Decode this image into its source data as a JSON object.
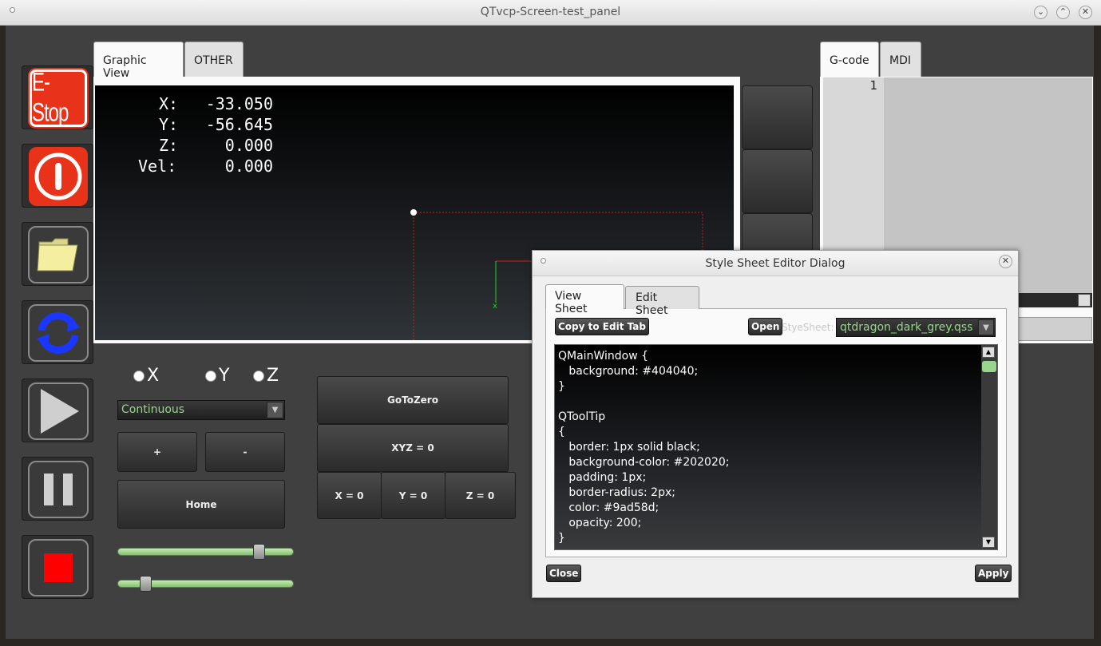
{
  "window": {
    "title": "QTvcp-Screen-test_panel",
    "minimize": "⌄",
    "maximize": "⌃",
    "close": "✕"
  },
  "toolbar": {
    "estop_label": "E-Stop",
    "icons": [
      "estop-icon",
      "power-icon",
      "folder-icon",
      "reload-icon",
      "play-icon",
      "pause-icon",
      "stop-icon"
    ]
  },
  "left_tabs": [
    {
      "label": "Graphic View",
      "active": true
    },
    {
      "label": "OTHER",
      "active": false
    }
  ],
  "dro": {
    "x_label": "X:",
    "x_value": "-33.050",
    "y_label": "Y:",
    "y_value": "-56.645",
    "z_label": "Z:",
    "z_value": "0.000",
    "vel_label": "Vel:",
    "vel_value": "0.000"
  },
  "right_tabs": [
    {
      "label": "G-code",
      "active": true
    },
    {
      "label": "MDI",
      "active": false
    }
  ],
  "gcode": {
    "line_number": "1"
  },
  "jog": {
    "axes": [
      "X",
      "Y",
      "Z"
    ],
    "mode": "Continuous",
    "plus_label": "+",
    "minus_label": "-",
    "home_label": "Home",
    "slider1_fraction": 0.83,
    "slider2_fraction": 0.13
  },
  "buttons": {
    "goto_zero": "GoToZero",
    "xyz_zero": "XYZ = 0",
    "x_zero": "X = 0",
    "y_zero": "Y = 0",
    "z_zero": "Z = 0"
  },
  "dialog": {
    "title": "Style Sheet Editor Dialog",
    "tabs": [
      {
        "label": "View Sheet",
        "active": true
      },
      {
        "label": "Edit Sheet",
        "active": false
      }
    ],
    "copy_button": "Copy to Edit Tab",
    "open_button": "Open",
    "stylesheet_label": "StyeSheet:",
    "stylesheet_value": "qtdragon_dark_grey.qss",
    "code_lines": [
      "QMainWindow {",
      "   background: #404040;",
      "}",
      "",
      "QToolTip",
      "{",
      "   border: 1px solid black;",
      "   background-color: #202020;",
      "   padding: 1px;",
      "   border-radius: 2px;",
      "   color: #9ad58d;",
      "   opacity: 200;",
      "}"
    ],
    "close_button": "Close",
    "apply_button": "Apply"
  },
  "colors": {
    "accent_green": "#9ad58d",
    "estop_red": "#e8331a",
    "main_bg": "#404040"
  }
}
